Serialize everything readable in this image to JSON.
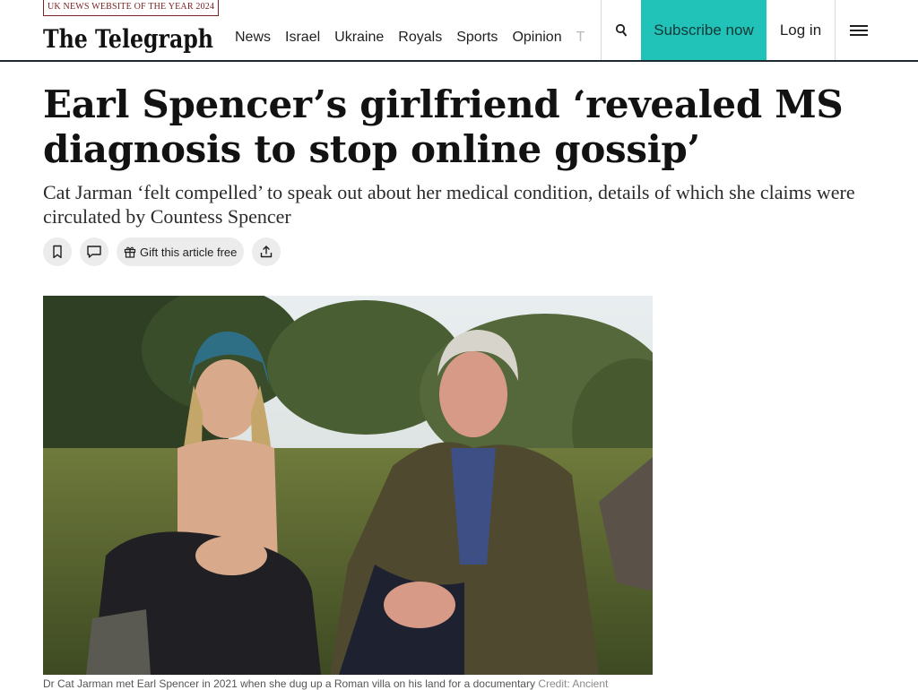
{
  "header": {
    "award_badge": "UK NEWS WEBSITE OF THE YEAR 2024",
    "logo_text": "The Telegraph",
    "nav": [
      "News",
      "Israel",
      "Ukraine",
      "Royals",
      "Sports",
      "Opinion",
      "T"
    ],
    "subscribe_label": "Subscribe now",
    "login_label": "Log in"
  },
  "article": {
    "headline": "Earl Spencer’s girlfriend ‘revealed MS diagnosis to stop online gossip’",
    "standfirst": "Cat Jarman ‘felt compelled’ to speak out about her medical condition, details of which she claims were circulated by Countess Spencer",
    "gift_label": "Gift this article free",
    "caption": "Dr Cat Jarman met Earl Spencer in 2021 when she dug up a Roman villa on his land for a documentary",
    "credit": "Credit: Ancient"
  },
  "colors": {
    "accent": "#21c2b8",
    "award": "#7a2323",
    "rule": "#1f2a33"
  },
  "icons": [
    "search-icon",
    "hamburger-menu-icon",
    "bookmark-icon",
    "comment-icon",
    "gift-icon",
    "share-icon"
  ]
}
